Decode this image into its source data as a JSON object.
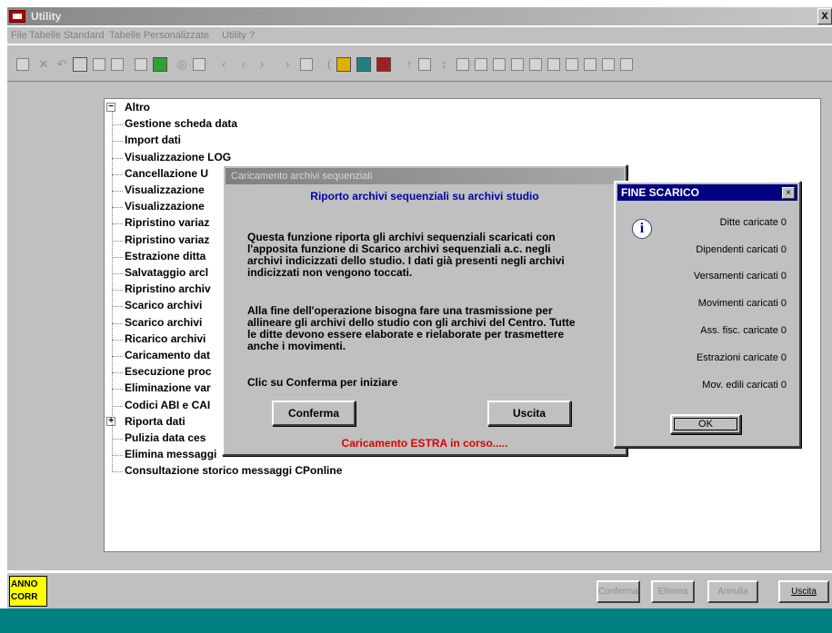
{
  "window": {
    "title": "Utility",
    "close_label": "X"
  },
  "menu": [
    "File",
    "Tabelle Standard",
    "Tabelle Personalizzate",
    "Utility",
    "?"
  ],
  "tree": [
    {
      "label": "Altro",
      "expander": "−",
      "level": 0
    },
    {
      "label": "Gestione scheda data",
      "level": 1
    },
    {
      "label": "Import dati",
      "level": 1
    },
    {
      "label": "Visualizzazione LOG",
      "level": 1
    },
    {
      "label": "Cancellazione U",
      "level": 1
    },
    {
      "label": "Visualizzazione",
      "level": 1
    },
    {
      "label": "Visualizzazione",
      "level": 1
    },
    {
      "label": "Ripristino variaz",
      "level": 1
    },
    {
      "label": "Ripristino variaz",
      "level": 1
    },
    {
      "label": "Estrazione ditta",
      "level": 1
    },
    {
      "label": "Salvataggio arcl",
      "level": 1
    },
    {
      "label": "Ripristino archiv",
      "level": 1
    },
    {
      "label": "Scarico archivi",
      "level": 1
    },
    {
      "label": "Scarico archivi",
      "level": 1
    },
    {
      "label": "Ricarico archivi",
      "level": 1
    },
    {
      "label": "Caricamento dat",
      "level": 1
    },
    {
      "label": "Esecuzione proc",
      "level": 1
    },
    {
      "label": "Eliminazione var",
      "level": 1
    },
    {
      "label": "Codici ABI e CAI",
      "level": 1
    },
    {
      "label": "Riporta dati",
      "expander": "+",
      "level": 0
    },
    {
      "label": "Pulizia data ces",
      "level": 1
    },
    {
      "label": "Elimina messaggi",
      "level": 1
    },
    {
      "label": "Consultazione storico messaggi CPonline",
      "level": 1
    }
  ],
  "dialog": {
    "title": "Caricamento archivi sequenziali",
    "subtitle": "Riporto archivi sequenziali su archivi studio",
    "para1": "Questa funzione riporta gli archivi sequenziali scaricati con\nl'apposita funzione di Scarico archivi sequenziali a.c. negli\narchivi indicizzati dello studio. I dati già presenti negli archivi\nindicizzati non vengono toccati.",
    "para2": "Alla fine dell'operazione bisogna fare una trasmissione per\nallineare gli archivi dello studio con gli archivi del Centro. Tutte\nle ditte devono essere elaborate e rielaborate per trasmettere\nanche i movimenti.",
    "para3": "Clic su Conferma per iniziare",
    "confirm_label": "Conferma",
    "exit_label": "Uscita",
    "status": "Caricamento ESTRA in corso....."
  },
  "info": {
    "title": "FINE SCARICO",
    "close_label": "×",
    "rows": [
      "Ditte caricate  0",
      "Dipendenti caricati  0",
      "Versamenti caricati  0",
      "Movimenti caricati  0",
      "Ass. fisc. caricate  0",
      "Estrazioni caricate  0",
      "Mov. edili caricati  0"
    ],
    "ok_label": "OK"
  },
  "bottom": {
    "anno_label": "ANNO\nCORR",
    "buttons": [
      "Conferma",
      "Elimina",
      "Annulla",
      "Uscita"
    ]
  },
  "colors": {
    "teal": "#008080",
    "title_blue": "#000080",
    "status_red": "#e00000",
    "link_blue": "#0000aa"
  }
}
